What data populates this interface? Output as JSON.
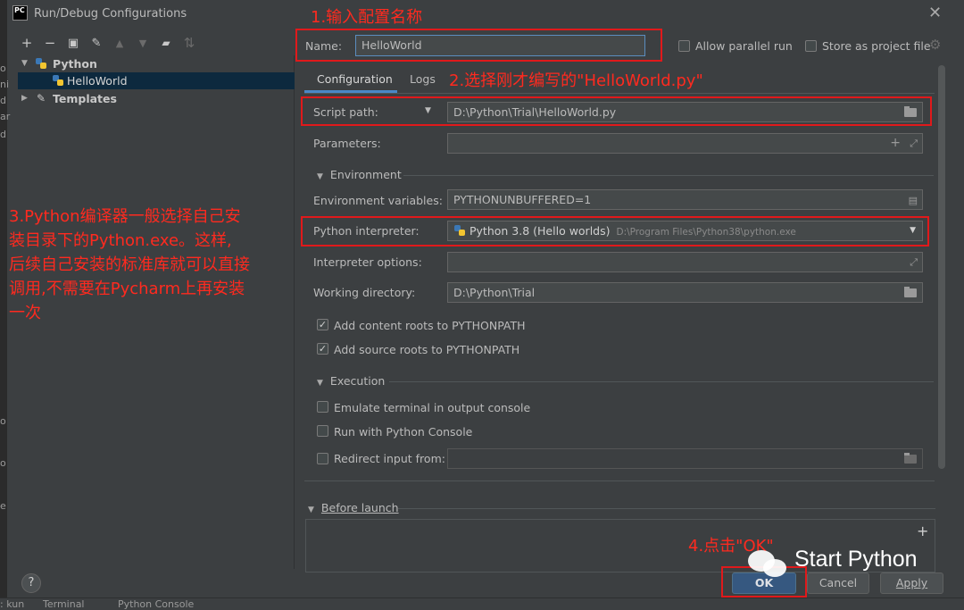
{
  "window": {
    "title": "Run/Debug Configurations",
    "logo": "PC"
  },
  "edge_fragments": [
    "o",
    "ni",
    "d",
    "ar",
    "d",
    "o",
    "o",
    "e",
    ": kun"
  ],
  "toolbar": {
    "add": "+",
    "remove": "−",
    "copy": "⧉",
    "edit": "🔧",
    "up": "▲",
    "down": "▼",
    "folder": "▬",
    "sort": "⇅"
  },
  "tree": {
    "python": "Python",
    "helloworld": "HelloWorld",
    "templates": "Templates"
  },
  "config": {
    "name_label": "Name:",
    "name_value": "HelloWorld",
    "allow_parallel": "Allow parallel run",
    "store_project": "Store as project file",
    "tab_configuration": "Configuration",
    "tab_logs": "Logs",
    "script_path_label": "Script path:",
    "script_path_value": "D:\\Python\\Trial\\HelloWorld.py",
    "parameters_label": "Parameters:",
    "environment_section": "Environment",
    "env_vars_label": "Environment variables:",
    "env_vars_value": "PYTHONUNBUFFERED=1",
    "interpreter_label": "Python interpreter:",
    "interpreter_value": "Python 3.8 (Hello worlds)",
    "interpreter_path": "D:\\Program Files\\Python38\\python.exe",
    "interp_options_label": "Interpreter options:",
    "workdir_label": "Working directory:",
    "workdir_value": "D:\\Python\\Trial",
    "add_content_roots": "Add content roots to PYTHONPATH",
    "add_source_roots": "Add source roots to PYTHONPATH",
    "execution_section": "Execution",
    "emulate_terminal": "Emulate terminal in output console",
    "run_python_console": "Run with Python Console",
    "redirect_input": "Redirect input from:",
    "before_launch": "Before launch",
    "before_launch_add": "+"
  },
  "buttons": {
    "ok": "OK",
    "cancel": "Cancel",
    "apply": "Apply",
    "help": "?"
  },
  "bottom_strip": {
    "terminal": "Terminal",
    "python_console": "Python Console"
  },
  "annotations": {
    "step1": "1.输入配置名称",
    "step2": "2.选择刚才编写的\"HelloWorld.py\"",
    "step3_lines": [
      "3.Python编译器一般选择自己安",
      "装目录下的Python.exe。这样,",
      "后续自己安装的标准库就可以直接",
      "调用,不需要在Pycharm上再安装",
      "一次"
    ],
    "step4": "4.点击\"OK\"",
    "color": "#ff2a1f"
  },
  "watermark": "Start Python"
}
